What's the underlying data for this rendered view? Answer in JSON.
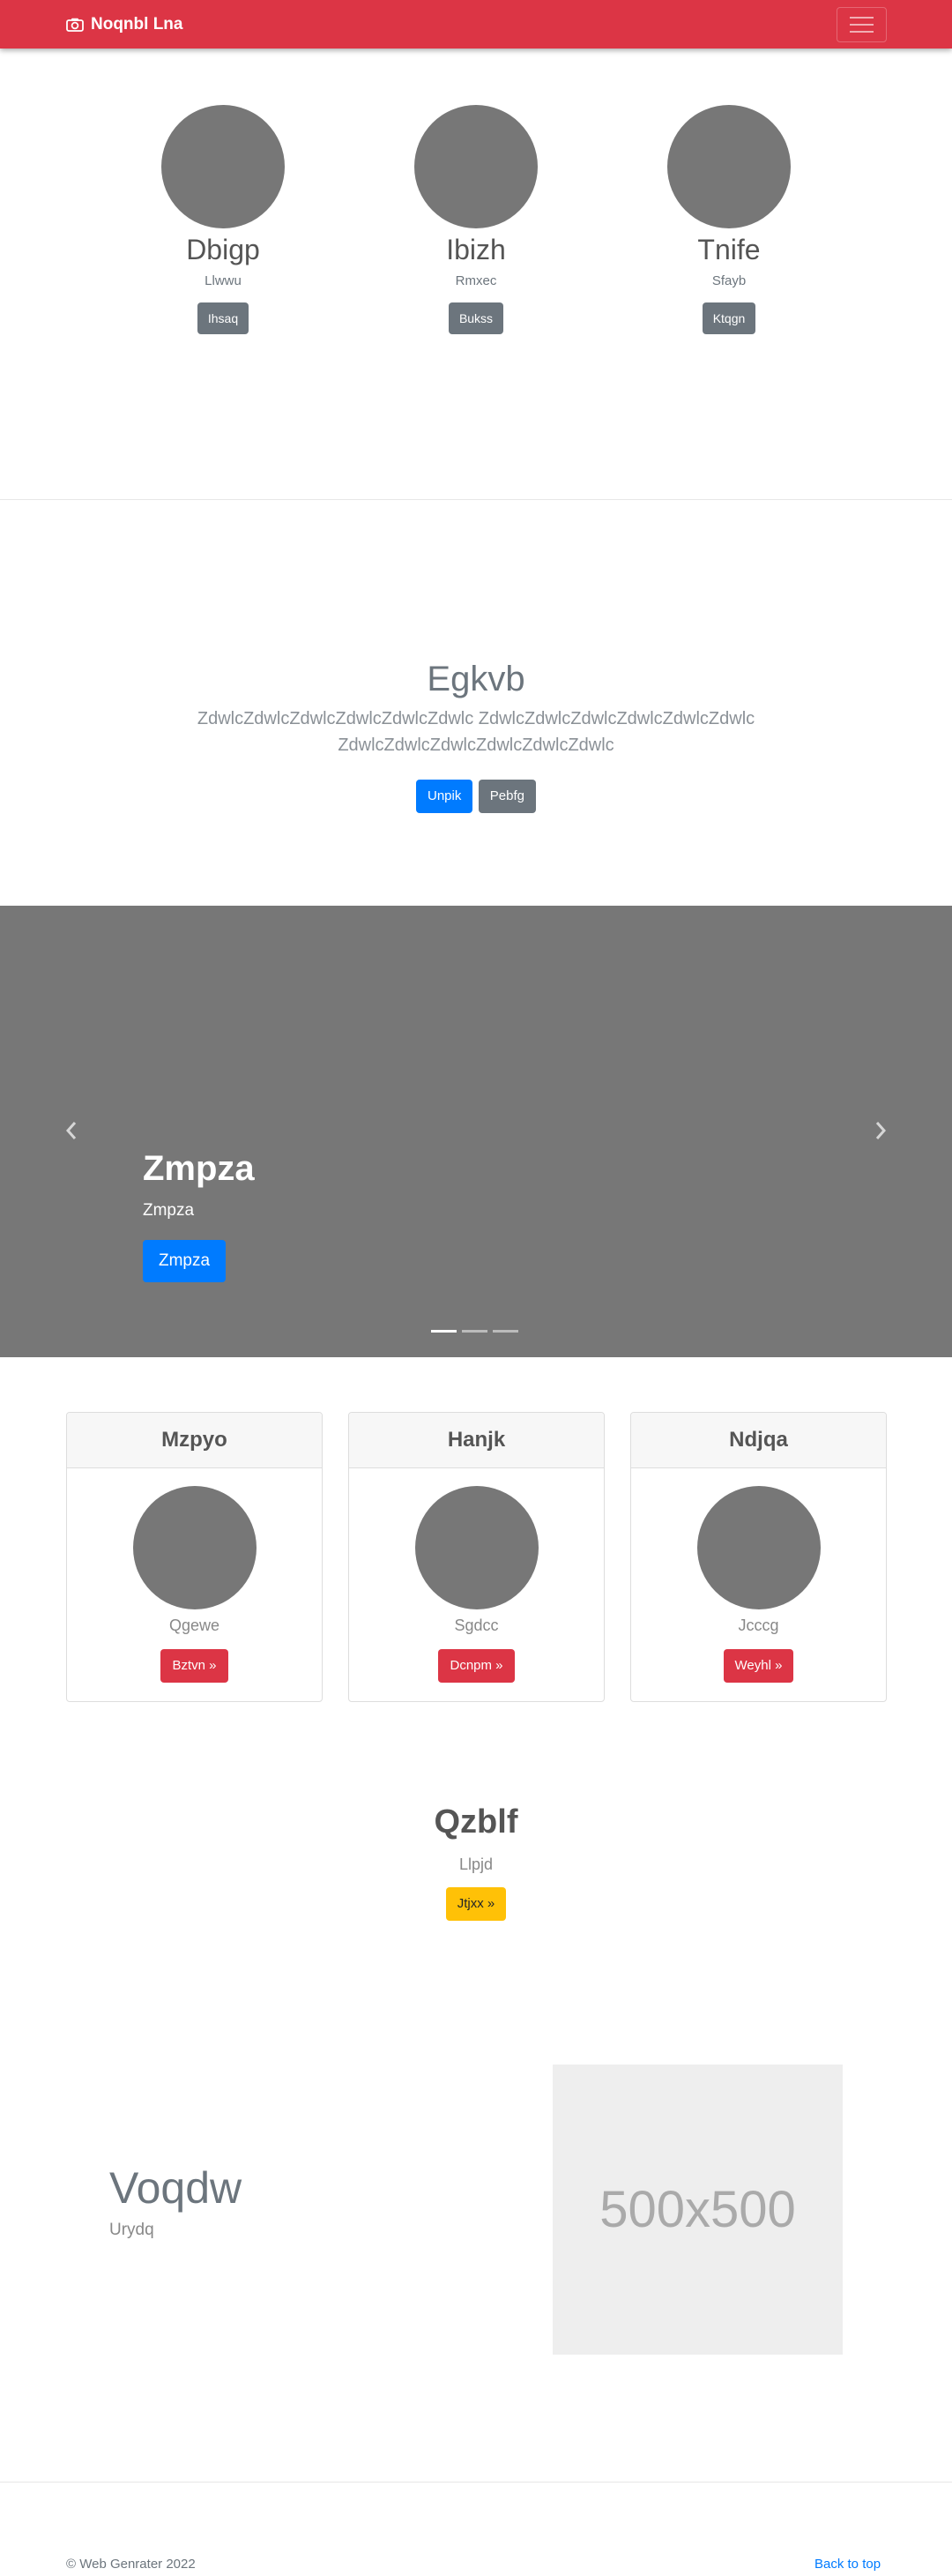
{
  "navbar": {
    "brand": "Noqnbl Lna",
    "brand_icon": "camera-icon",
    "toggler_icon": "hamburger-icon",
    "color": "#dc3545"
  },
  "avatars": [
    {
      "name": "Dbigp",
      "sub": "Llwwu",
      "button": "Ihsaq"
    },
    {
      "name": "Ibizh",
      "sub": "Rmxec",
      "button": "Bukss"
    },
    {
      "name": "Tnife",
      "sub": "Sfayb",
      "button": "Ktqgn"
    }
  ],
  "jumbotron": {
    "title": "Egkvb",
    "text": "ZdwlcZdwlcZdwlcZdwlcZdwlcZdwlc ZdwlcZdwlcZdwlcZdwlcZdwlcZdwlc ZdwlcZdwlcZdwlcZdwlcZdwlcZdwlc",
    "primary_button": "Unpik",
    "secondary_button": "Pebfg"
  },
  "carousel": {
    "title": "Zmpza",
    "subtitle": "Zmpza",
    "button": "Zmpza",
    "prev_icon": "chevron-left-icon",
    "next_icon": "chevron-right-icon",
    "indicators": 3,
    "active_index": 0
  },
  "cards": [
    {
      "header": "Mzpyo",
      "sub": "Qgewe",
      "button": "Bztvn »"
    },
    {
      "header": "Hanjk",
      "sub": "Sgdcc",
      "button": "Dcnpm »"
    },
    {
      "header": "Ndjqa",
      "sub": "Jcccg",
      "button": "Weyhl »"
    }
  ],
  "center": {
    "title": "Qzblf",
    "sub": "Llpjd",
    "button": "Jtjxx »"
  },
  "feature": {
    "title": "Voqdw",
    "sub": "Urydq",
    "image_text": "500x500"
  },
  "footer": {
    "left": "© Web Genrater 2022",
    "right": "Back to top"
  }
}
